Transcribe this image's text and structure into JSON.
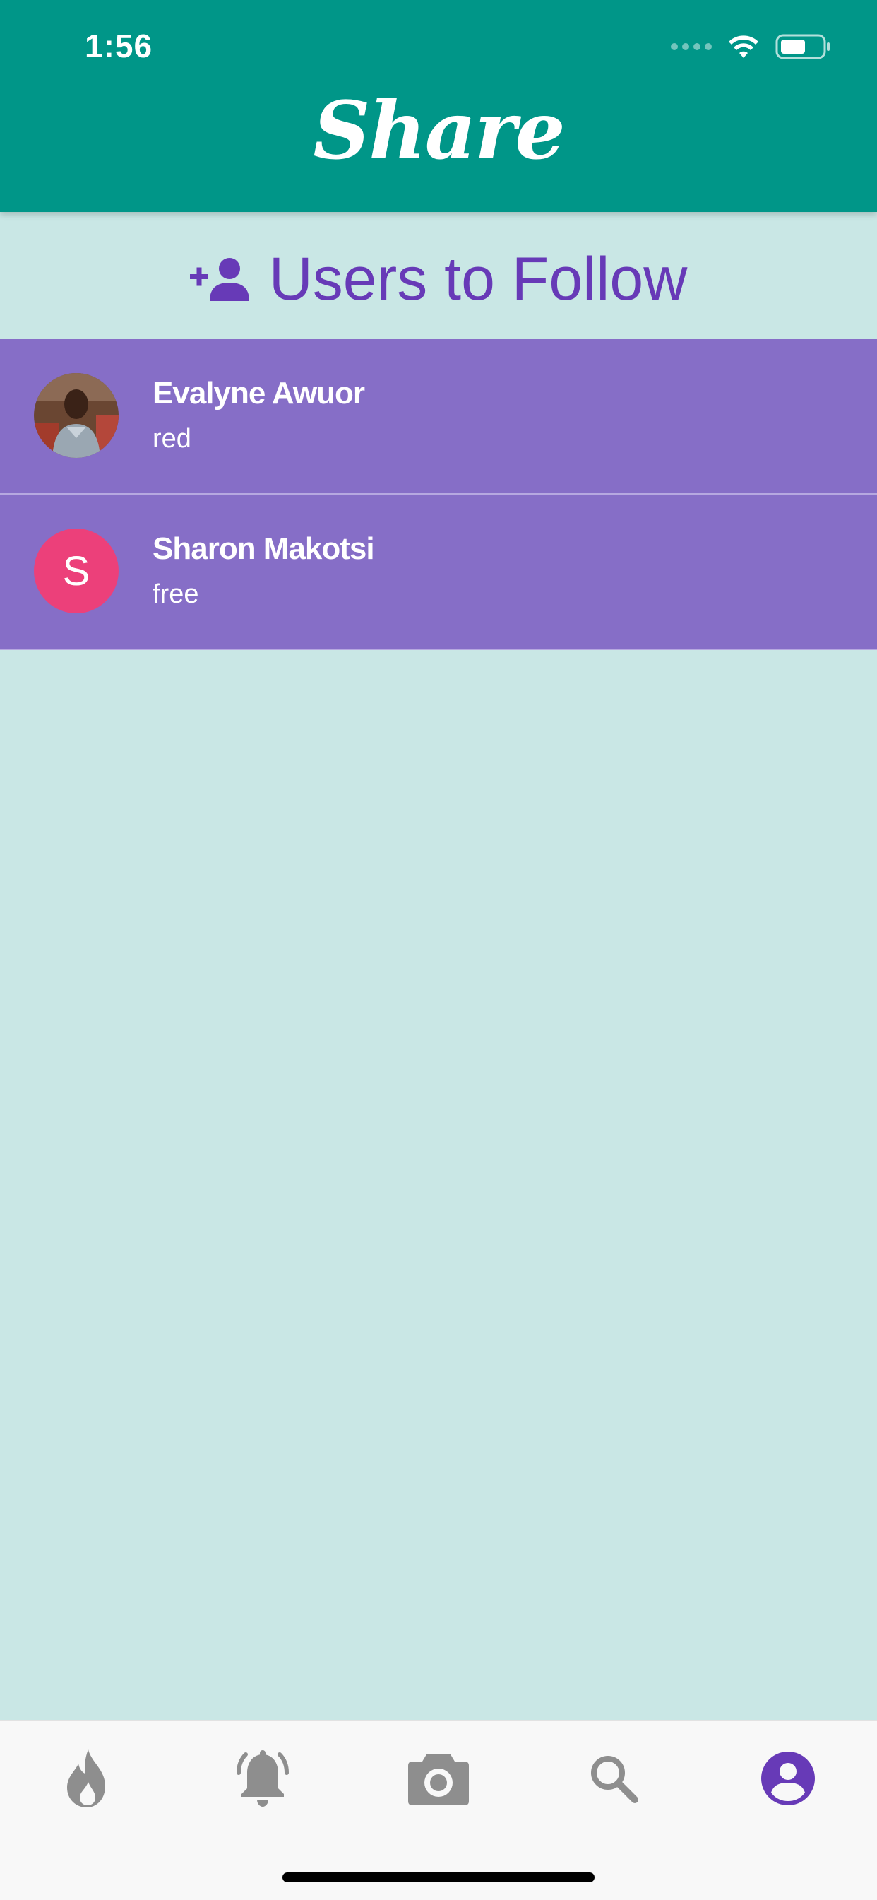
{
  "status_bar": {
    "time": "1:56"
  },
  "header": {
    "title": "Share"
  },
  "section": {
    "title": "Users to Follow",
    "icon": "person-add-icon"
  },
  "users": [
    {
      "name": "Evalyne Awuor",
      "status": "red",
      "avatar_type": "photo"
    },
    {
      "name": "Sharon Makotsi",
      "status": "free",
      "avatar_type": "letter",
      "avatar_letter": "S"
    }
  ],
  "tabs": [
    {
      "icon": "flame-icon",
      "active": false
    },
    {
      "icon": "bell-icon",
      "active": false
    },
    {
      "icon": "camera-icon",
      "active": false
    },
    {
      "icon": "search-icon",
      "active": false
    },
    {
      "icon": "account-circle-icon",
      "active": true
    }
  ],
  "colors": {
    "header": "#009688",
    "background": "#c9e7e5",
    "accent": "#673ab7",
    "row": "#866ec7",
    "avatar_letter_bg": "#ec407a",
    "tab_inactive": "#8e8e8e"
  }
}
